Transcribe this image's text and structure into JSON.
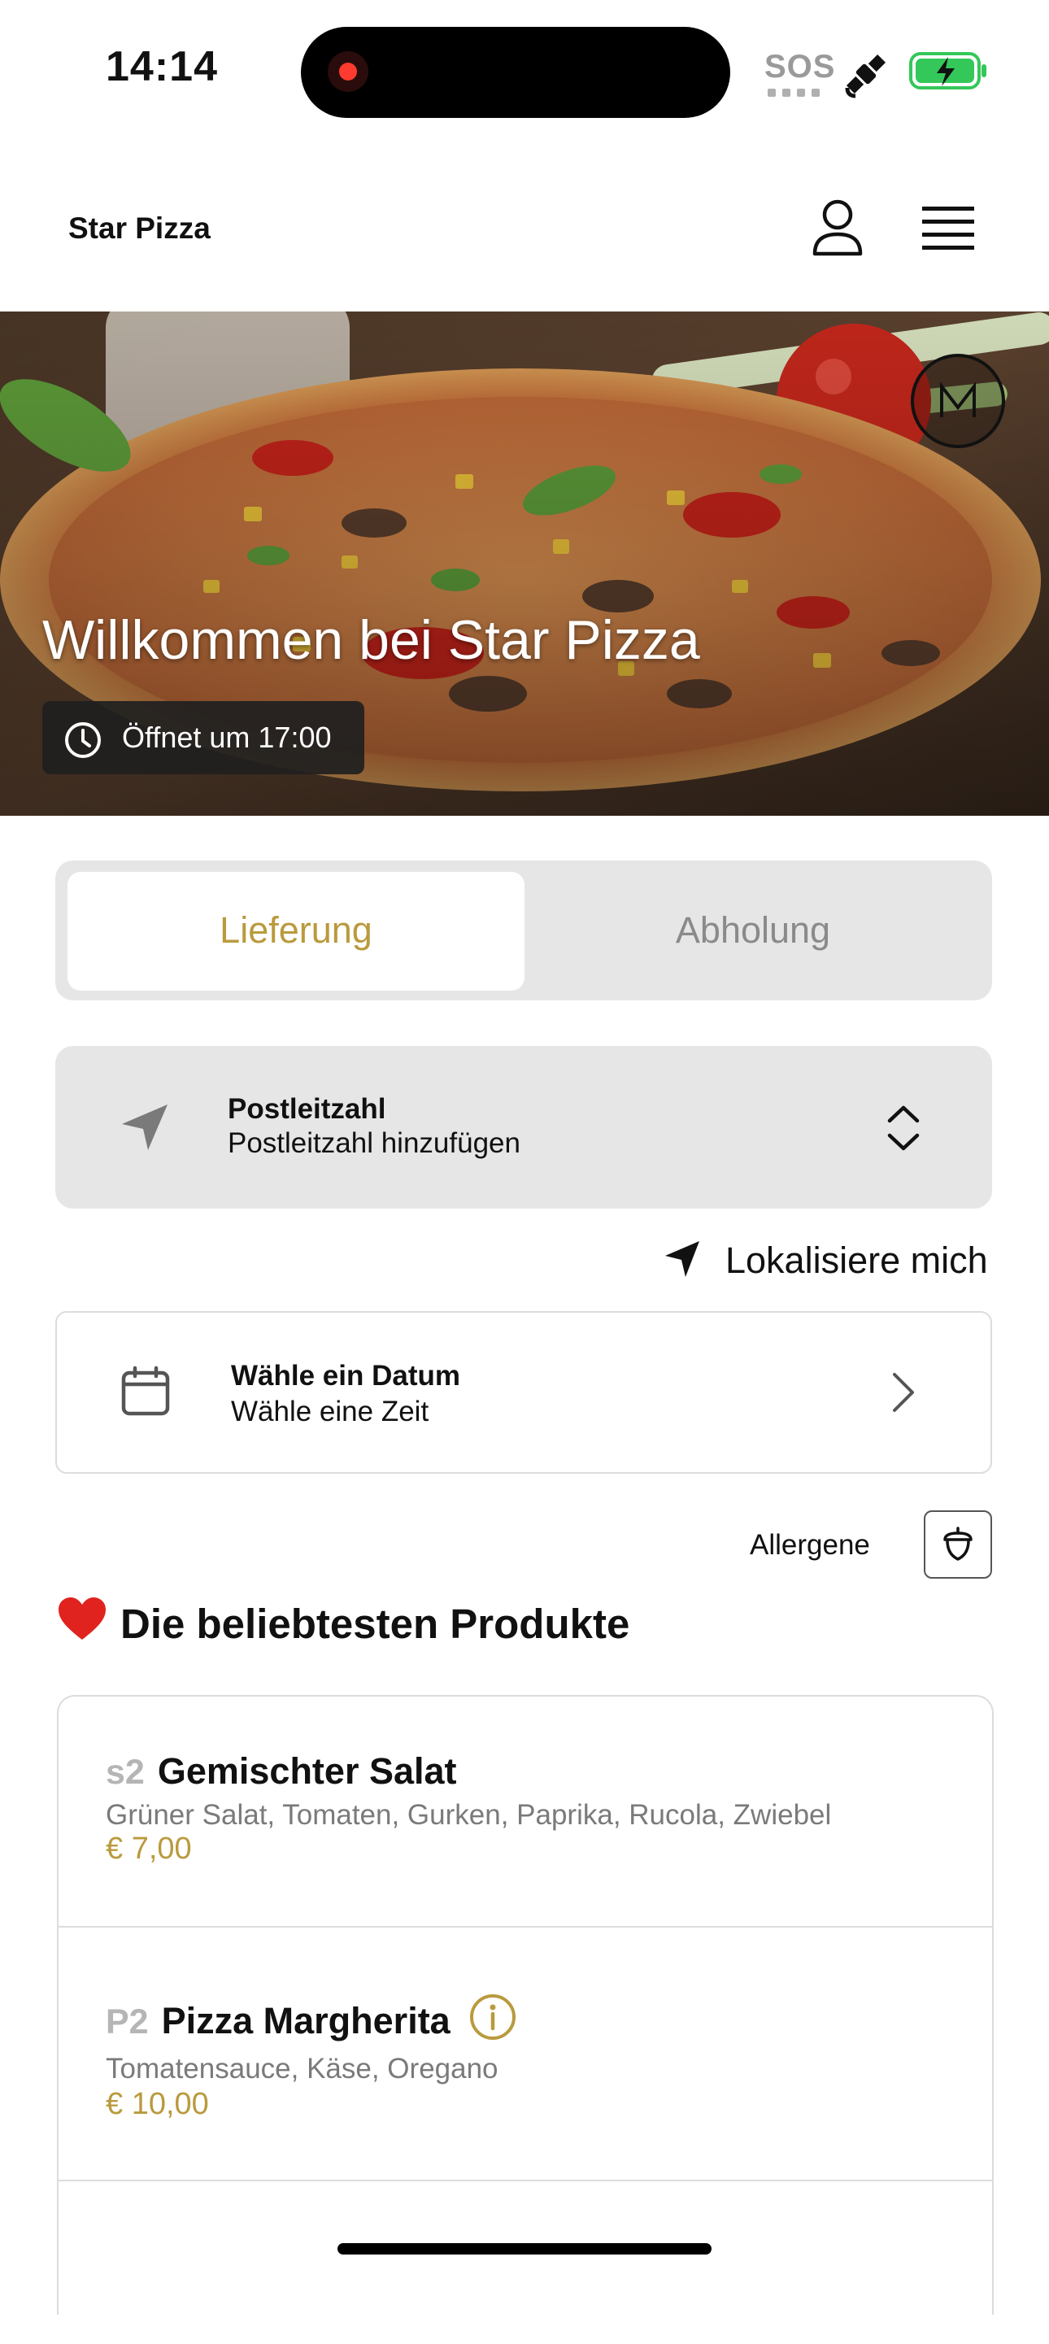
{
  "status_bar": {
    "time": "14:14",
    "sos": "SOS"
  },
  "header": {
    "brand": "Star Pizza",
    "icons": [
      "user-icon",
      "menu-icon"
    ]
  },
  "hero": {
    "title": "Willkommen bei Star Pizza",
    "open_status": "Öffnet um 17:00"
  },
  "order_mode": {
    "tabs": [
      "Lieferung",
      "Abholung"
    ],
    "selected": "Lieferung"
  },
  "postal": {
    "title": "Postleitzahl",
    "placeholder": "Postleitzahl hinzufügen"
  },
  "locate_label": "Lokalisiere mich",
  "date_picker": {
    "title": "Wähle ein Datum",
    "subtitle": "Wähle eine Zeit"
  },
  "allergens_label": "Allergene",
  "section": {
    "emoji": "❤️",
    "title": "Die beliebtesten Produkte"
  },
  "products": [
    {
      "code": "s2",
      "name": "Gemischter Salat",
      "description": "Grüner Salat, Tomaten, Gurken, Paprika, Rucola, Zwiebel",
      "price": "€ 7,00",
      "info_icon": false
    },
    {
      "code": "P2",
      "name": "Pizza Margherita",
      "description": "Tomatensauce, Käse, Oregano",
      "price": "€ 10,00",
      "info_icon": true
    }
  ],
  "colors": {
    "accent": "#B99A3D",
    "muted_tab": "#8A8A8A",
    "field_bg": "#E6E6E6"
  }
}
